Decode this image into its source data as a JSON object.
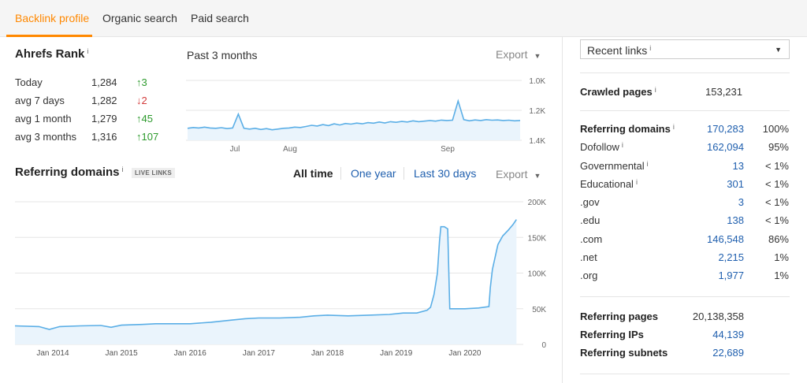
{
  "tabs": [
    {
      "label": "Backlink profile",
      "active": true
    },
    {
      "label": "Organic search",
      "active": false
    },
    {
      "label": "Paid search",
      "active": false
    }
  ],
  "ahrefs_rank": {
    "title": "Ahrefs Rank",
    "info": "i",
    "period_label": "Past 3 months",
    "export_label": "Export",
    "rows": [
      {
        "label": "Today",
        "value": "1,284",
        "arrow": "↑",
        "change": "3",
        "direction": "up"
      },
      {
        "label": "avg 7 days",
        "value": "1,282",
        "arrow": "↓",
        "change": "2",
        "direction": "down"
      },
      {
        "label": "avg 1 month",
        "value": "1,279",
        "arrow": "↑",
        "change": "45",
        "direction": "up"
      },
      {
        "label": "avg 3 months",
        "value": "1,316",
        "arrow": "↑",
        "change": "107",
        "direction": "up"
      }
    ]
  },
  "referring_domains_section": {
    "title": "Referring domains",
    "info": "i",
    "badge": "LIVE LINKS",
    "ranges": [
      {
        "label": "All time",
        "active": true
      },
      {
        "label": "One year",
        "active": false
      },
      {
        "label": "Last 30 days",
        "active": false
      }
    ],
    "export_label": "Export"
  },
  "chart_data": [
    {
      "type": "line",
      "title": "Ahrefs Rank",
      "period": "Past 3 months",
      "x_tick_labels": [
        "Jul",
        "Aug",
        "Sep"
      ],
      "y_tick_labels": [
        "1.0K",
        "1.2K",
        "1.4K"
      ],
      "ylim": [
        1000,
        1400
      ],
      "y_inverted": true,
      "grid": true,
      "series": [
        {
          "values": [
            1320,
            1315,
            1318,
            1312,
            1318,
            1320,
            1316,
            1322,
            1318,
            1225,
            1320,
            1325,
            1320,
            1328,
            1322,
            1330,
            1325,
            1320,
            1318,
            1312,
            1315,
            1308,
            1300,
            1305,
            1295,
            1302,
            1290,
            1298,
            1288,
            1292,
            1285,
            1290,
            1282,
            1286,
            1278,
            1284,
            1276,
            1280,
            1274,
            1278,
            1270,
            1276,
            1272,
            1268,
            1272,
            1265,
            1268,
            1266,
            1138,
            1262,
            1270,
            1264,
            1268,
            1262,
            1266,
            1264,
            1268,
            1266,
            1270,
            1268
          ]
        }
      ]
    },
    {
      "type": "area",
      "title": "Referring domains",
      "x_tick_labels": [
        "Jan 2014",
        "Jan 2015",
        "Jan 2016",
        "Jan 2017",
        "Jan 2018",
        "Jan 2019",
        "Jan 2020"
      ],
      "y_tick_labels": [
        "200K",
        "150K",
        "100K",
        "50K",
        "0"
      ],
      "xlim": [
        2013.45,
        2020.85
      ],
      "ylim": [
        0,
        200000
      ],
      "grid": true,
      "series": [
        {
          "points": [
            [
              2013.45,
              26000
            ],
            [
              2013.8,
              25000
            ],
            [
              2013.95,
              21000
            ],
            [
              2014.1,
              25000
            ],
            [
              2014.4,
              26000
            ],
            [
              2014.7,
              26500
            ],
            [
              2014.85,
              24000
            ],
            [
              2015.0,
              27000
            ],
            [
              2015.3,
              28000
            ],
            [
              2015.5,
              29000
            ],
            [
              2015.8,
              29000
            ],
            [
              2016.0,
              29000
            ],
            [
              2016.3,
              31000
            ],
            [
              2016.6,
              34000
            ],
            [
              2016.8,
              36000
            ],
            [
              2017.0,
              37000
            ],
            [
              2017.3,
              37000
            ],
            [
              2017.6,
              38000
            ],
            [
              2017.8,
              40000
            ],
            [
              2018.0,
              41000
            ],
            [
              2018.3,
              40000
            ],
            [
              2018.6,
              41000
            ],
            [
              2018.9,
              42000
            ],
            [
              2019.1,
              44000
            ],
            [
              2019.3,
              44000
            ],
            [
              2019.45,
              48000
            ],
            [
              2019.5,
              52000
            ],
            [
              2019.55,
              70000
            ],
            [
              2019.6,
              100000
            ],
            [
              2019.63,
              145000
            ],
            [
              2019.65,
              165000
            ],
            [
              2019.7,
              165000
            ],
            [
              2019.75,
              162000
            ],
            [
              2019.78,
              50000
            ],
            [
              2020.0,
              50000
            ],
            [
              2020.2,
              51000
            ],
            [
              2020.35,
              53000
            ],
            [
              2020.37,
              80000
            ],
            [
              2020.4,
              105000
            ],
            [
              2020.48,
              140000
            ],
            [
              2020.55,
              152000
            ],
            [
              2020.63,
              160000
            ],
            [
              2020.7,
              168000
            ],
            [
              2020.75,
              175000
            ]
          ]
        }
      ]
    }
  ],
  "right_panel": {
    "select": {
      "label": "Recent links",
      "info": "i",
      "caret": "▼"
    },
    "crawled_pages": {
      "label": "Crawled pages",
      "info": "i",
      "value": "153,231"
    },
    "referring_domains": {
      "label": "Referring domains",
      "info": "i",
      "value": "170,283",
      "pct": "100%"
    },
    "breakdown": [
      {
        "label": "Dofollow",
        "info": "i",
        "value": "162,094",
        "pct": "95%"
      },
      {
        "label": "Governmental",
        "info": "i",
        "value": "13",
        "pct": "< 1%"
      },
      {
        "label": "Educational",
        "info": "i",
        "value": "301",
        "pct": "< 1%"
      },
      {
        "label": ".gov",
        "info": "",
        "value": "3",
        "pct": "< 1%"
      },
      {
        "label": ".edu",
        "info": "",
        "value": "138",
        "pct": "< 1%"
      },
      {
        "label": ".com",
        "info": "",
        "value": "146,548",
        "pct": "86%"
      },
      {
        "label": ".net",
        "info": "",
        "value": "2,215",
        "pct": "1%"
      },
      {
        "label": ".org",
        "info": "",
        "value": "1,977",
        "pct": "1%"
      }
    ],
    "bottom": [
      {
        "label": "Referring pages",
        "value": "20,138,358",
        "link": false
      },
      {
        "label": "Referring IPs",
        "value": "44,139",
        "link": true
      },
      {
        "label": "Referring subnets",
        "value": "22,689",
        "link": true
      }
    ]
  },
  "colors": {
    "accent": "#ff8800",
    "link": "#1f5fae",
    "line": "#5aaee6",
    "fill": "#eaf4fc",
    "up": "#2c9a2c",
    "down": "#d23a3a"
  }
}
